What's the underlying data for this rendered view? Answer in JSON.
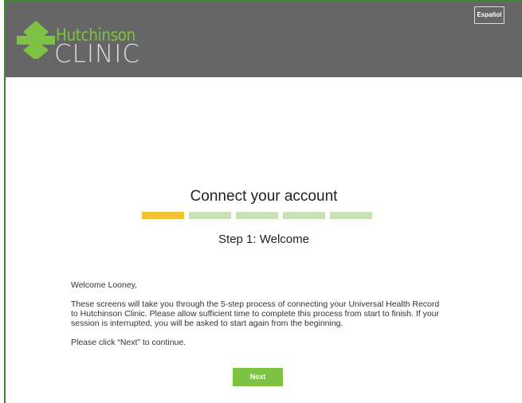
{
  "header": {
    "logo_line1": "Hutchinson",
    "logo_line2": "CLINIC",
    "language_button": "Español"
  },
  "main": {
    "title": "Connect your account",
    "progress": {
      "total_steps": 5,
      "current_step": 1
    },
    "step_label": "Step 1: Welcome",
    "greeting": "Welcome Looney,",
    "description": "These screens will take you through the 5-step process of connecting your Universal Health Record to Hutchinson Clinic. Please allow sufficient time to complete this process from start to finish. If your session is interrupted, you will be asked to start again from the beginning.",
    "instruction": "Please click “Next” to continue.",
    "next_button": "Next"
  },
  "colors": {
    "header_bg": "#666666",
    "brand_green": "#7dc242",
    "progress_active": "#f2c232",
    "progress_inactive": "#c9e1b6"
  }
}
